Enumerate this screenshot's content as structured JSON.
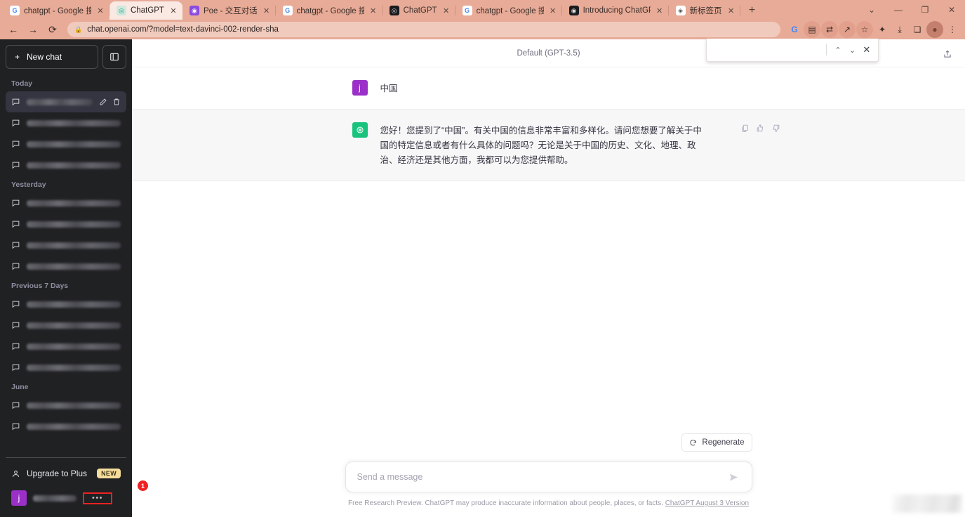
{
  "browser": {
    "tabs": [
      {
        "title": "chatgpt - Google 搜索",
        "favicon": "google-icon",
        "favicon_class": "fav-g",
        "glyph": "G",
        "active": false
      },
      {
        "title": "ChatGPT",
        "favicon": "chatgpt-icon",
        "favicon_class": "fav-chatgpt",
        "glyph": "◎",
        "active": true
      },
      {
        "title": "Poe - 交互对话",
        "favicon": "poe-icon",
        "favicon_class": "fav-poe",
        "glyph": "◉",
        "active": false
      },
      {
        "title": "chatgpt - Google 搜索",
        "favicon": "google-icon",
        "favicon_class": "fav-g",
        "glyph": "G",
        "active": false
      },
      {
        "title": "ChatGPT",
        "favicon": "chatgpt-icon",
        "favicon_class": "fav-dark",
        "glyph": "◎",
        "active": false
      },
      {
        "title": "chatgpt - Google 搜索",
        "favicon": "google-icon",
        "favicon_class": "fav-g",
        "glyph": "G",
        "active": false
      },
      {
        "title": "Introducing ChatGPT",
        "favicon": "openai-icon",
        "favicon_class": "fav-dark",
        "glyph": "◉",
        "active": false
      },
      {
        "title": "新标签页",
        "favicon": "newtab-icon",
        "favicon_class": "fav-new",
        "glyph": "◈",
        "active": false
      }
    ],
    "new_tab_label": "+",
    "close_glyph": "✕",
    "window_controls": {
      "minimize_group": "⌄",
      "minimize": "—",
      "maximize": "❐",
      "close": "✕"
    },
    "nav": {
      "back": "←",
      "forward": "→",
      "reload": "⟳"
    },
    "omnibox": {
      "lock": "🔒",
      "url": "chat.openai.com/?model=text-davinci-002-render-sha"
    },
    "toolbar_icons": [
      {
        "name": "google-lens-icon",
        "glyph": "G"
      },
      {
        "name": "reading-list-icon",
        "glyph": "▤"
      },
      {
        "name": "translate-icon",
        "glyph": "⇄"
      },
      {
        "name": "share-icon",
        "glyph": "↗"
      },
      {
        "name": "bookmark-star-icon",
        "glyph": "☆"
      },
      {
        "name": "extensions-puzzle-icon",
        "glyph": "✦"
      },
      {
        "name": "downloads-icon",
        "glyph": "⤓"
      },
      {
        "name": "side-panel-icon",
        "glyph": "❏"
      },
      {
        "name": "profile-icon",
        "glyph": "●"
      },
      {
        "name": "chrome-menu-icon",
        "glyph": "⋮"
      }
    ]
  },
  "findbar": {
    "value": "",
    "placeholder": "",
    "prev_label": "⌃",
    "next_label": "⌄",
    "close_label": "✕"
  },
  "sidebar": {
    "new_chat_label": "New chat",
    "new_chat_plus": "+",
    "groups": [
      {
        "label": "Today",
        "items": [
          {
            "redacted": true,
            "active": true
          },
          {
            "redacted": true,
            "active": false
          },
          {
            "redacted": true,
            "active": false
          },
          {
            "redacted": true,
            "active": false
          }
        ]
      },
      {
        "label": "Yesterday",
        "items": [
          {
            "redacted": true,
            "active": false
          },
          {
            "redacted": true,
            "active": false
          },
          {
            "redacted": true,
            "active": false
          },
          {
            "redacted": true,
            "active": false
          }
        ]
      },
      {
        "label": "Previous 7 Days",
        "items": [
          {
            "redacted": true,
            "active": false
          },
          {
            "redacted": true,
            "active": false
          },
          {
            "redacted": true,
            "active": false
          },
          {
            "redacted": true,
            "active": false
          }
        ]
      },
      {
        "label": "June",
        "items": [
          {
            "redacted": true,
            "active": false
          },
          {
            "redacted": true,
            "active": false
          }
        ]
      }
    ],
    "upgrade_label": "Upgrade to Plus",
    "new_badge": "NEW",
    "user_avatar_letter": "j",
    "user_menu_dots": "•••",
    "annotation_badge": "1"
  },
  "main": {
    "model_label": "Default (GPT-3.5)",
    "messages": [
      {
        "role": "user",
        "avatar_letter": "j",
        "text": "中国"
      },
      {
        "role": "assistant",
        "avatar_letter": "",
        "text": "您好！您提到了“中国”。有关中国的信息非常丰富和多样化。请问您想要了解关于中国的特定信息或者有什么具体的问题吗？无论是关于中国的历史、文化、地理、政治、经济还是其他方面，我都可以为您提供帮助。"
      }
    ],
    "regenerate_label": "Regenerate",
    "composer_placeholder": "Send a message",
    "composer_value": "",
    "disclaimer_text": "Free Research Preview. ChatGPT may produce inaccurate information about people, places, or facts.",
    "disclaimer_link": "ChatGPT August 3 Version"
  },
  "colors": {
    "browser_chrome": "#e7ab97",
    "sidebar_bg": "#202123",
    "assistant_row_bg": "#f7f7f8",
    "avatar_user": "#9b30c8",
    "avatar_assistant": "#19c37d",
    "annotation_red": "#ee2222",
    "badge_yellow": "#f5dd9b"
  }
}
